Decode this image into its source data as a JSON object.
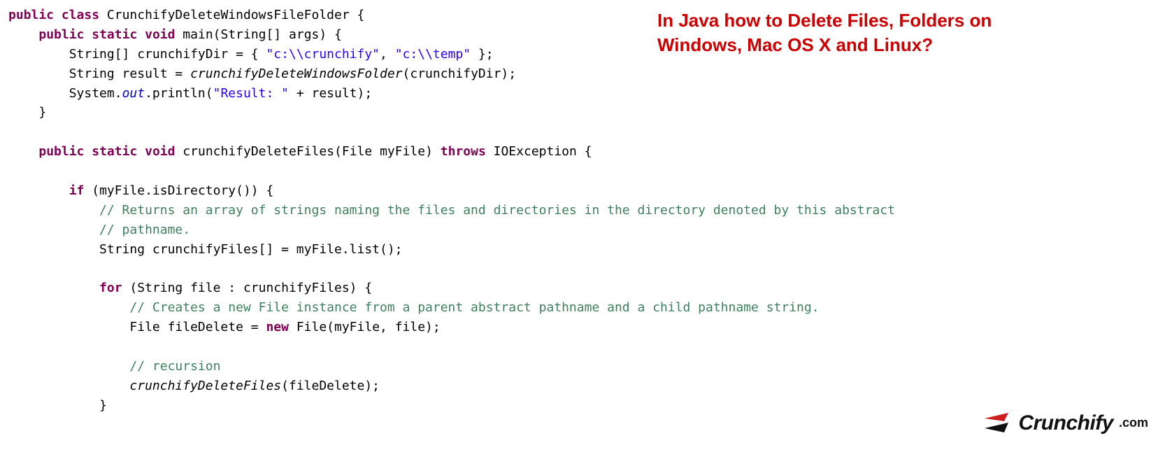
{
  "banner": {
    "line1": "In Java how to Delete Files, Folders on",
    "line2": "Windows, Mac OS X and Linux?"
  },
  "logo": {
    "brand": "Crunchify",
    "suffix": ".com",
    "colors": {
      "red": "#cc1e1e",
      "black": "#111111"
    }
  },
  "code": {
    "tokens": [
      [
        {
          "t": "kw",
          "v": "public"
        },
        {
          "t": "p",
          "v": " "
        },
        {
          "t": "kw",
          "v": "class"
        },
        {
          "t": "p",
          "v": " CrunchifyDeleteWindowsFileFolder {"
        }
      ],
      [
        {
          "t": "p",
          "v": "    "
        },
        {
          "t": "kw",
          "v": "public"
        },
        {
          "t": "p",
          "v": " "
        },
        {
          "t": "kw",
          "v": "static"
        },
        {
          "t": "p",
          "v": " "
        },
        {
          "t": "kw",
          "v": "void"
        },
        {
          "t": "p",
          "v": " main(String[] args) {"
        }
      ],
      [
        {
          "t": "p",
          "v": "        String[] crunchifyDir = { "
        },
        {
          "t": "str",
          "v": "\"c:\\\\crunchify\""
        },
        {
          "t": "p",
          "v": ", "
        },
        {
          "t": "str",
          "v": "\"c:\\\\temp\""
        },
        {
          "t": "p",
          "v": " };"
        }
      ],
      [
        {
          "t": "p",
          "v": "        String result = "
        },
        {
          "t": "ital",
          "v": "crunchifyDeleteWindowsFolder"
        },
        {
          "t": "p",
          "v": "(crunchifyDir);"
        }
      ],
      [
        {
          "t": "p",
          "v": "        System."
        },
        {
          "t": "stat",
          "v": "out"
        },
        {
          "t": "p",
          "v": ".println("
        },
        {
          "t": "str",
          "v": "\"Result: \""
        },
        {
          "t": "p",
          "v": " + result);"
        }
      ],
      [
        {
          "t": "p",
          "v": "    }"
        }
      ],
      [
        {
          "t": "p",
          "v": ""
        }
      ],
      [
        {
          "t": "p",
          "v": "    "
        },
        {
          "t": "kw",
          "v": "public"
        },
        {
          "t": "p",
          "v": " "
        },
        {
          "t": "kw",
          "v": "static"
        },
        {
          "t": "p",
          "v": " "
        },
        {
          "t": "kw",
          "v": "void"
        },
        {
          "t": "p",
          "v": " crunchifyDeleteFiles(File myFile) "
        },
        {
          "t": "kw",
          "v": "throws"
        },
        {
          "t": "p",
          "v": " IOException {"
        }
      ],
      [
        {
          "t": "p",
          "v": ""
        }
      ],
      [
        {
          "t": "p",
          "v": "        "
        },
        {
          "t": "kw",
          "v": "if"
        },
        {
          "t": "p",
          "v": " (myFile.isDirectory()) {"
        }
      ],
      [
        {
          "t": "p",
          "v": "            "
        },
        {
          "t": "cmt",
          "v": "// Returns an array of strings naming the files and directories in the directory denoted by this abstract"
        }
      ],
      [
        {
          "t": "p",
          "v": "            "
        },
        {
          "t": "cmt",
          "v": "// pathname."
        }
      ],
      [
        {
          "t": "p",
          "v": "            String crunchifyFiles[] = myFile.list();"
        }
      ],
      [
        {
          "t": "p",
          "v": ""
        }
      ],
      [
        {
          "t": "p",
          "v": "            "
        },
        {
          "t": "kw",
          "v": "for"
        },
        {
          "t": "p",
          "v": " (String file : crunchifyFiles) {"
        }
      ],
      [
        {
          "t": "p",
          "v": "                "
        },
        {
          "t": "cmt",
          "v": "// Creates a new File instance from a parent abstract pathname and a child pathname string."
        }
      ],
      [
        {
          "t": "p",
          "v": "                File fileDelete = "
        },
        {
          "t": "kw",
          "v": "new"
        },
        {
          "t": "p",
          "v": " File(myFile, file);"
        }
      ],
      [
        {
          "t": "p",
          "v": ""
        }
      ],
      [
        {
          "t": "p",
          "v": "                "
        },
        {
          "t": "cmt",
          "v": "// recursion"
        }
      ],
      [
        {
          "t": "p",
          "v": "                "
        },
        {
          "t": "ital",
          "v": "crunchifyDeleteFiles"
        },
        {
          "t": "p",
          "v": "(fileDelete);"
        }
      ],
      [
        {
          "t": "p",
          "v": "            }"
        }
      ]
    ]
  }
}
